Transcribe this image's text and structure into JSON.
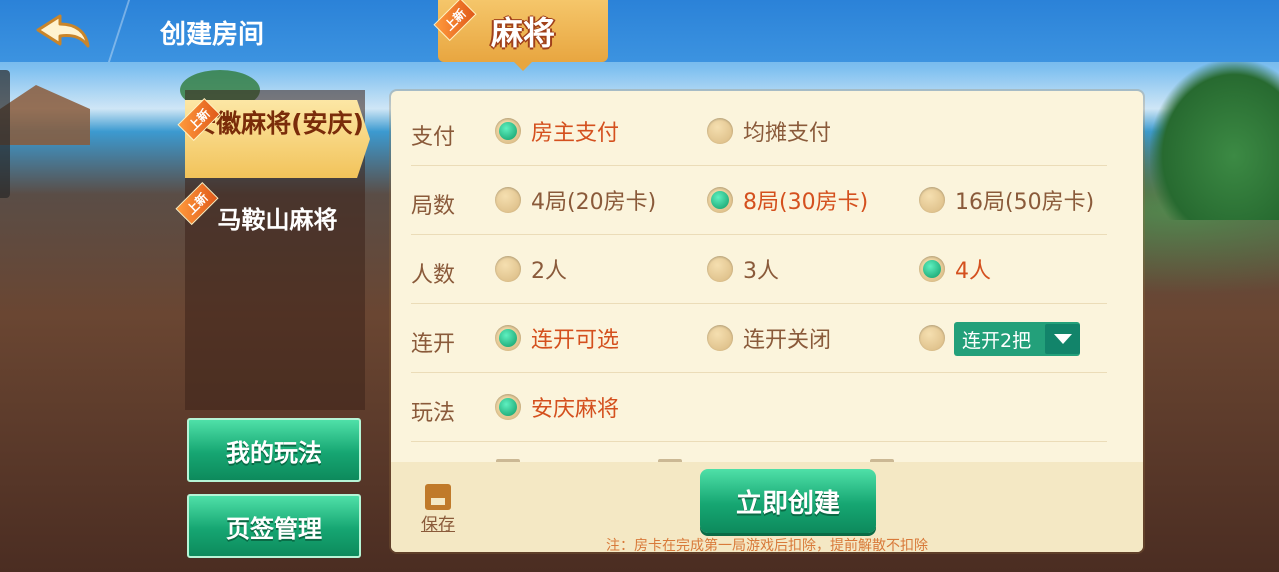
{
  "header": {
    "title": "创建房间",
    "game_tab": "麻将",
    "new_badge": "上新"
  },
  "sidebar": {
    "items": [
      {
        "label": "安徽麻将(安庆)",
        "badge": "上新",
        "active": true
      },
      {
        "label": "马鞍山麻将",
        "badge": "上新",
        "active": false
      }
    ],
    "my_rules_label": "我的玩法",
    "tab_manage_label": "页签管理"
  },
  "rows": [
    {
      "label": "支付",
      "options": [
        {
          "text": "房主支付",
          "selected": true
        },
        {
          "text": "均摊支付",
          "selected": false
        }
      ]
    },
    {
      "label": "局数",
      "options": [
        {
          "text": "4局(20房卡)",
          "selected": false
        },
        {
          "text": "8局(30房卡)",
          "selected": true
        },
        {
          "text": "16局(50房卡)",
          "selected": false
        }
      ]
    },
    {
      "label": "人数",
      "options": [
        {
          "text": "2人",
          "selected": false
        },
        {
          "text": "3人",
          "selected": false
        },
        {
          "text": "4人",
          "selected": true
        }
      ]
    },
    {
      "label": "连开",
      "options": [
        {
          "text": "连开可选",
          "selected": true
        },
        {
          "text": "连开关闭",
          "selected": false
        }
      ],
      "dropdown_value": "连开2把"
    },
    {
      "label": "玩法",
      "options": [
        {
          "text": "安庆麻将",
          "selected": true
        }
      ]
    }
  ],
  "footer": {
    "save_label": "保存",
    "create_label": "立即创建",
    "note": "注：房卡在完成第一局游戏后扣除，提前解散不扣除"
  },
  "colors": {
    "accent_green": "#16a672",
    "selected_text": "#d4501e",
    "label_brown": "#8a5a3a",
    "tab_gold": "#e8a640"
  }
}
